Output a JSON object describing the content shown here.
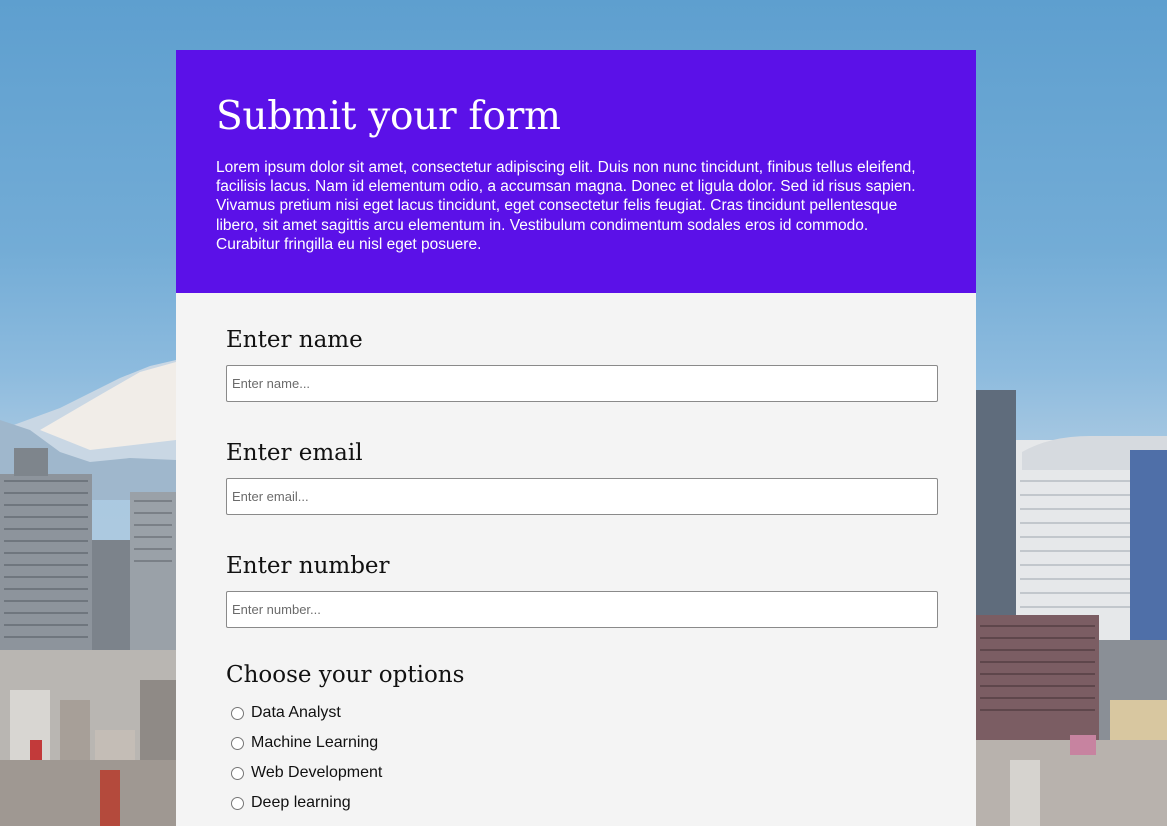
{
  "header": {
    "title": "Submit your form",
    "description": "Lorem ipsum dolor sit amet, consectetur adipiscing elit. Duis non nunc tincidunt, finibus tellus eleifend, facilisis lacus. Nam id elementum odio, a accumsan magna. Donec et ligula dolor. Sed id risus sapien. Vivamus pretium nisi eget lacus tincidunt, eget consectetur felis feugiat. Cras tincidunt pellentesque libero, sit amet sagittis arcu elementum in. Vestibulum condimentum sodales eros id commodo. Curabitur fringilla eu nisl eget posuere."
  },
  "fields": {
    "name": {
      "label": "Enter name",
      "placeholder": "Enter name...",
      "value": ""
    },
    "email": {
      "label": "Enter email",
      "placeholder": "Enter email...",
      "value": ""
    },
    "number": {
      "label": "Enter number",
      "placeholder": "Enter number...",
      "value": ""
    }
  },
  "options": {
    "label": "Choose your options",
    "items": [
      "Data Analyst",
      "Machine Learning",
      "Web Development",
      "Deep learning"
    ],
    "selected": null
  },
  "colors": {
    "header_bg": "#5b11e8",
    "card_bg": "#f4f4f4",
    "text": "#111111"
  }
}
